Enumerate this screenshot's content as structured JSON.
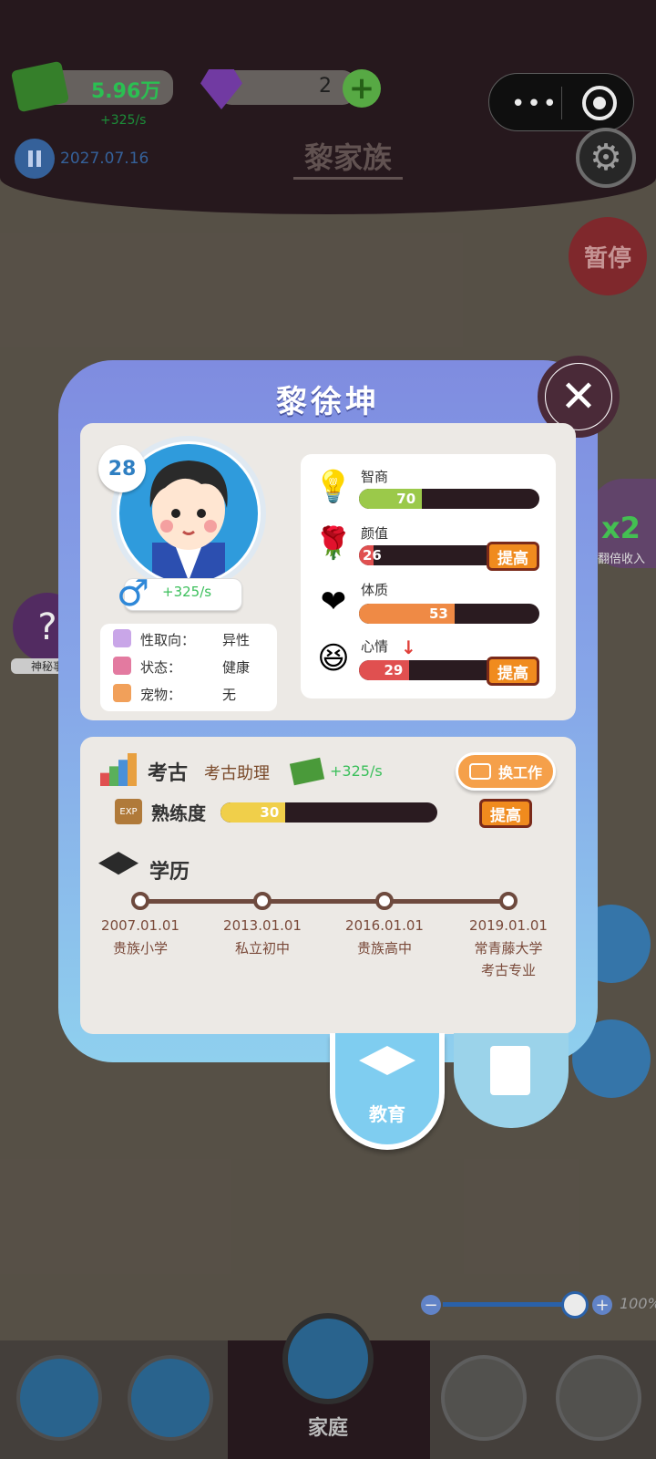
{
  "status_bar": {
    "money": "5.96万",
    "money_sub": "+325/s",
    "gems": "2",
    "date": "2027.07.16",
    "family_title": "黎家族"
  },
  "side": {
    "pause_label": "暂停",
    "mystery_label": "神秘事",
    "x2_badge": "x2",
    "x2_label": "翻倍收入",
    "zoom_level": "100%"
  },
  "bottom_nav": {
    "family_label": "家庭"
  },
  "modal": {
    "name": "黎徐坤",
    "age": "28",
    "income": "+325/s",
    "info": [
      {
        "key": "性取向：",
        "value": "异性"
      },
      {
        "key": "状态：",
        "value": "健康"
      },
      {
        "key": "宠物：",
        "value": "无"
      }
    ],
    "stats": [
      {
        "label": "智商",
        "value": 70,
        "fill": 0.35,
        "color": "#9bc94a"
      },
      {
        "label": "颜值",
        "value": 26,
        "fill": 0.08,
        "color": "#e05050",
        "boost": "提高"
      },
      {
        "label": "体质",
        "value": 53,
        "fill": 0.53,
        "color": "#ef8a45"
      },
      {
        "label": "心情",
        "value": 29,
        "fill": 0.28,
        "color": "#e05050",
        "boost": "提高"
      }
    ],
    "work": {
      "field": "考古",
      "title": "考古助理",
      "income": "+325/s",
      "switch_label": "换工作",
      "skill_label": "熟练度",
      "skill_value": 30,
      "skill_fill": 0.3,
      "boost_label": "提高"
    },
    "education": {
      "label": "学历",
      "timeline": [
        {
          "date": "2007.01.01",
          "school": "贵族小学"
        },
        {
          "date": "2013.01.01",
          "school": "私立初中"
        },
        {
          "date": "2016.01.01",
          "school": "贵族高中"
        },
        {
          "date": "2019.01.01",
          "school": "常青藤大学\n考古专业"
        }
      ]
    },
    "tabs": {
      "edu_label": "教育"
    }
  }
}
